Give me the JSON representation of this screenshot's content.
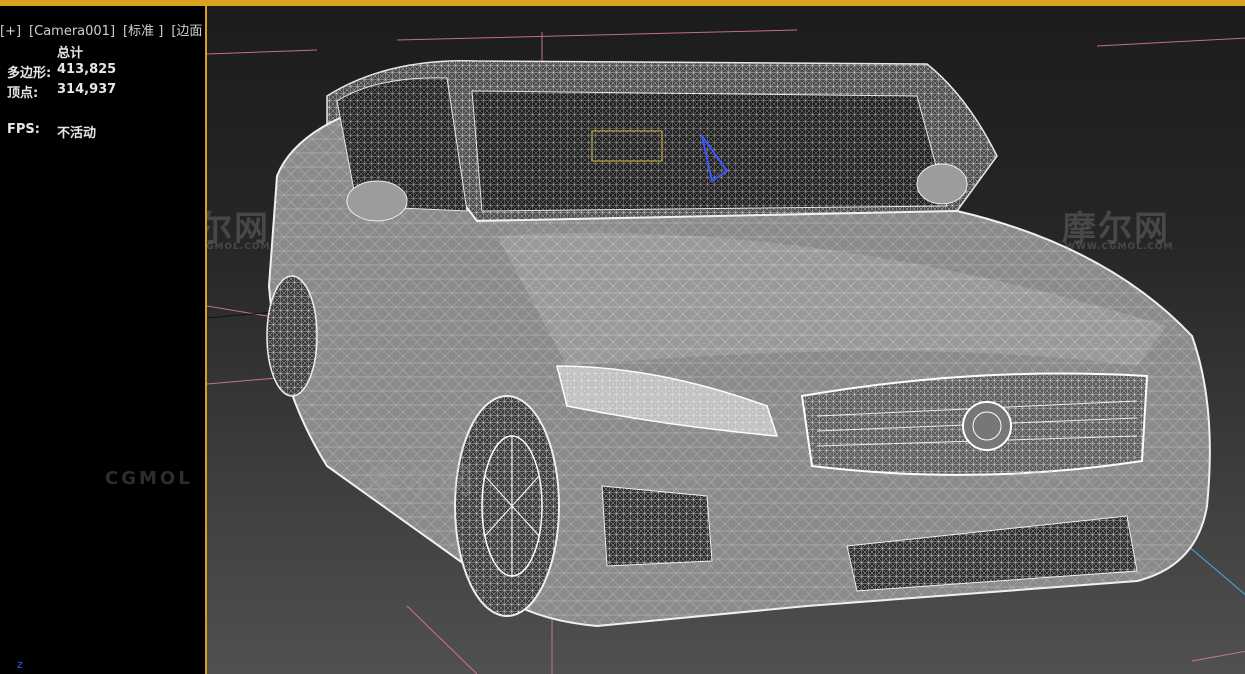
{
  "viewport_label": {
    "plus": "[+]",
    "camera": "[Camera001]",
    "shading": "[标准 ]",
    "mode": "[边面 ]"
  },
  "stats": {
    "header": "总计",
    "polygons_label": "多边形:",
    "polygons_value": "413,825",
    "vertices_label": "顶点:",
    "vertices_value": "314,937",
    "fps_label": "FPS:",
    "fps_value": "不活动"
  },
  "watermarks": {
    "brand_cn": "摩尔网",
    "brand_url": "WWW.CGMOL.COM",
    "brand_latin": "CGMOL"
  },
  "axis_label": "z",
  "colors": {
    "viewport_border": "#d6a21f",
    "wireframe": "#e6e6e6",
    "grid_lines": "#e07aa8",
    "axis_z": "#3b55ff"
  },
  "icons": [
    "car-wireframe-model"
  ]
}
